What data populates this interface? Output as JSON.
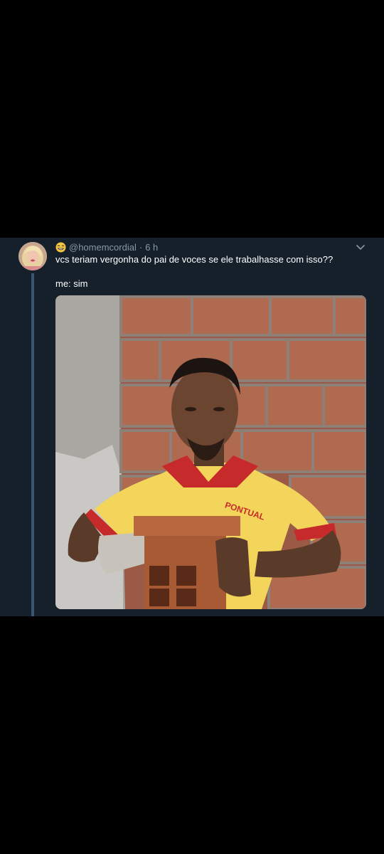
{
  "tweet": {
    "handle": "@homemcordial",
    "separator": "·",
    "time": "6 h",
    "text_line1": "vcs teriam vergonha do pai de voces se ele trabalhasse com isso??",
    "text_line2": "me: sim",
    "avatar_icon": "profile-avatar",
    "badge_icon": "smiling-face-emoji",
    "menu_icon": "chevron-down-icon",
    "shirt_text": "PONTUAL"
  },
  "colors": {
    "background": "#000000",
    "card_background": "#15202b",
    "secondary_text": "#8899a6",
    "primary_text": "#ffffff",
    "thread_line": "#3b5470"
  }
}
